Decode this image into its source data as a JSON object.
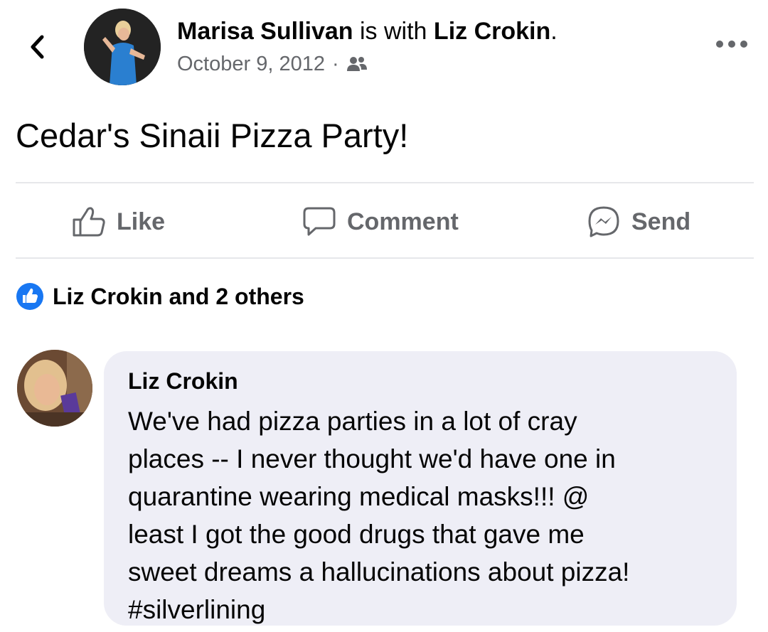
{
  "post": {
    "author_name": "Marisa Sullivan",
    "with_phrase": "is with",
    "tagged_name": "Liz Crokin",
    "tagged_suffix": ".",
    "date": "October 9, 2012",
    "separator": "·",
    "privacy_icon": "friends-icon",
    "text": "Cedar's Sinaii Pizza Party!"
  },
  "header": {
    "back_icon": "chevron-left-icon",
    "more_icon": "more-horizontal-icon"
  },
  "actions": {
    "like_label": "Like",
    "comment_label": "Comment",
    "send_label": "Send"
  },
  "reactions": {
    "summary": "Liz Crokin and 2 others",
    "icon": "like-badge-icon"
  },
  "comment": {
    "author": "Liz Crokin",
    "lines": [
      "We've had pizza parties in a lot of cray",
      "places -- I never thought we'd have one in",
      "quarantine wearing medical masks!!! @",
      "least I got the good drugs that gave me",
      "sweet dreams a hallucinations about pizza!",
      "#silverlining"
    ]
  },
  "colors": {
    "text": "#050505",
    "secondary_text": "#65676b",
    "like_blue": "#1877f2",
    "bubble_bg": "#eeeef6",
    "divider": "#e6e7ea"
  }
}
